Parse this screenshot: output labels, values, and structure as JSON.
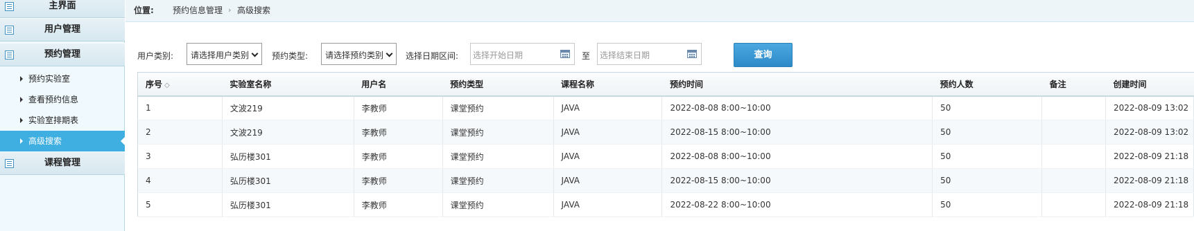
{
  "sidebar": {
    "menus": [
      {
        "label": "主界面"
      },
      {
        "label": "用户管理"
      },
      {
        "label": "预约管理"
      },
      {
        "label": "课程管理"
      }
    ],
    "sub_items": [
      {
        "label": "预约实验室"
      },
      {
        "label": "查看预约信息"
      },
      {
        "label": "实验室排期表"
      },
      {
        "label": "高级搜索"
      }
    ]
  },
  "breadcrumb": {
    "prefix": "位置:",
    "items": [
      "预约信息管理",
      "高级搜索"
    ],
    "separator": "›"
  },
  "filters": {
    "user_type_label": "用户类别:",
    "user_type_value": "请选择用户类别",
    "booking_type_label": "预约类型:",
    "booking_type_value": "请选择预约类别",
    "date_range_label": "选择日期区间:",
    "start_placeholder": "选择开始日期",
    "to_label": "至",
    "end_placeholder": "选择结束日期",
    "query_label": "查询"
  },
  "table": {
    "columns": [
      "序号",
      "实验室名称",
      "用户名",
      "预约类型",
      "课程名称",
      "预约时间",
      "预约人数",
      "备注",
      "创建时间"
    ],
    "sort_indicator": "◇",
    "rows": [
      [
        "1",
        "文波219",
        "李教师",
        "课堂预约",
        "JAVA",
        "2022-08-08 8:00~10:00",
        "50",
        "",
        "2022-08-09 13:02"
      ],
      [
        "2",
        "文波219",
        "李教师",
        "课堂预约",
        "JAVA",
        "2022-08-15 8:00~10:00",
        "50",
        "",
        "2022-08-09 13:02"
      ],
      [
        "3",
        "弘历楼301",
        "李教师",
        "课堂预约",
        "JAVA",
        "2022-08-08 8:00~10:00",
        "50",
        "",
        "2022-08-09 21:18"
      ],
      [
        "4",
        "弘历楼301",
        "李教师",
        "课堂预约",
        "JAVA",
        "2022-08-15 8:00~10:00",
        "50",
        "",
        "2022-08-09 21:18"
      ],
      [
        "5",
        "弘历楼301",
        "李教师",
        "课堂预约",
        "JAVA",
        "2022-08-22 8:00~10:00",
        "50",
        "",
        "2022-08-09 21:18"
      ]
    ]
  }
}
